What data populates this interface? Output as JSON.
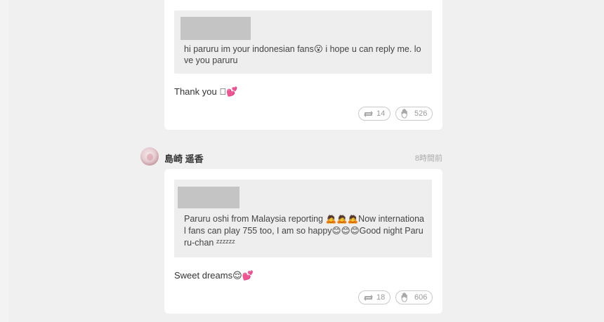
{
  "posts": [
    {
      "quote": "hi paruru im your indonesian fans😮 i hope u can reply me. love you paruru",
      "reply": "Thank you 🏻💕",
      "retweet_count": "14",
      "like_count": "526"
    },
    {
      "author": "島崎 遥香",
      "time": "8時間前",
      "quote": "Paruru oshi from Malaysia reporting 🙇🙇🙇Now international fans can play 755 too, I am so happy😊😊😊Good night Paruru-chan ᶻᶻᶻᶻᶻᶻ",
      "reply": "Sweet dreams😌💕",
      "retweet_count": "18",
      "like_count": "606"
    }
  ],
  "icons": {
    "retweet": "retweet-icon",
    "like": "raised-hand-icon"
  },
  "colors": {
    "background": "#f0f0f0",
    "card": "#ffffff",
    "quote_bg": "#eeeeee",
    "pill_border": "#c9c9c9",
    "muted_text": "#9a9a9a"
  }
}
